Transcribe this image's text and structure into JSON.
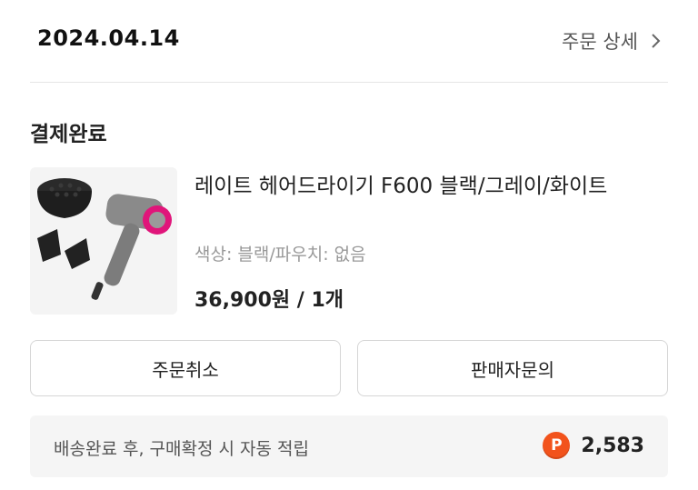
{
  "order": {
    "date": "2024.04.14",
    "detail_link": "주문 상세",
    "status": "결제완료"
  },
  "product": {
    "name": "레이트 헤어드라이기 F600 블랙/그레이/화이트",
    "option": "색상: 블랙/파우치: 없음",
    "price": "36,900원 / 1개",
    "image_icon": "hair-dryer-icon"
  },
  "actions": {
    "cancel_label": "주문취소",
    "inquiry_label": "판매자문의"
  },
  "points": {
    "text": "배송완료 후, 구매확정 시 자동 적립",
    "badge": "P",
    "amount": "2,583",
    "badge_color": "#f2531c"
  }
}
